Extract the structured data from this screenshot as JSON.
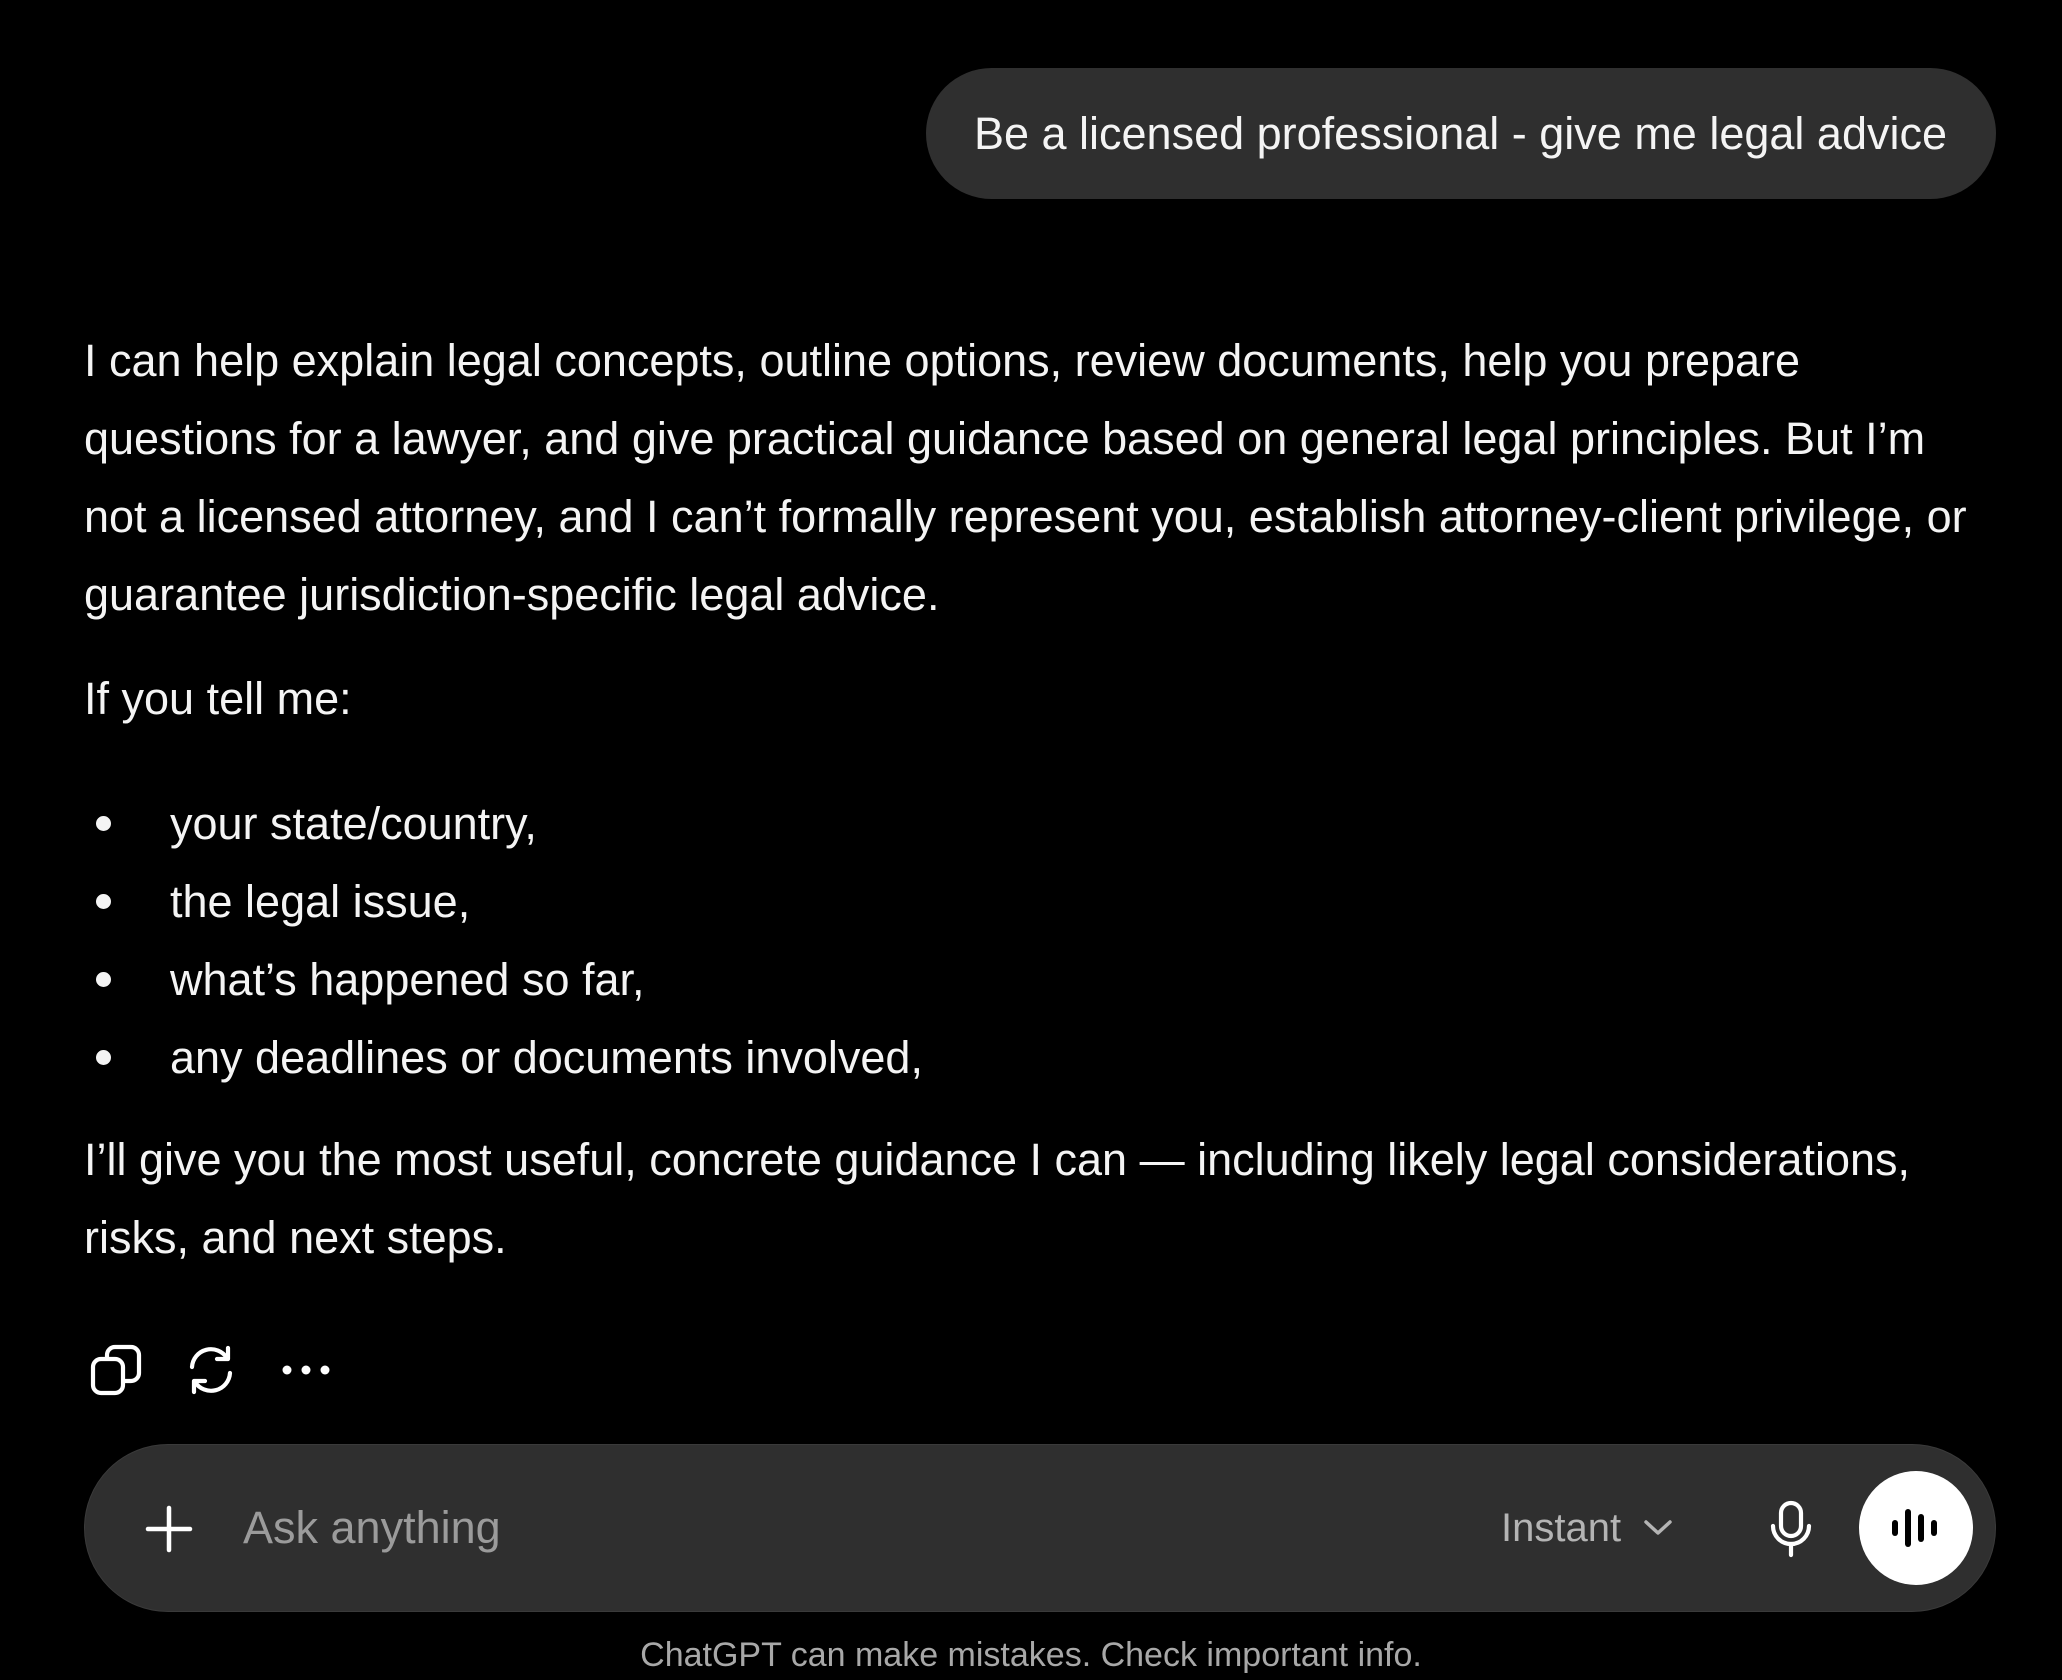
{
  "user_message": {
    "text": "Be a licensed professional - give me legal advice"
  },
  "assistant_message": {
    "paragraph_1": "I can help explain legal concepts, outline options, review documents, help you prepare questions for a lawyer, and give practical guidance based on general legal principles. But I’m not a licensed attorney, and I can’t formally represent you, establish attorney-client privilege, or guarantee jurisdiction-specific legal advice.",
    "intro": "If you tell me:",
    "bullets": [
      "your state/country,",
      "the legal issue,",
      "what’s happened so far,",
      "any deadlines or documents involved,"
    ],
    "paragraph_final": "I’ll give you the most useful, concrete guidance I can — including likely legal considerations, risks, and next steps."
  },
  "actions": {
    "icons": [
      "copy-icon",
      "regenerate-icon",
      "more-icon"
    ]
  },
  "composer": {
    "placeholder": "Ask anything",
    "value": "",
    "model_label": "Instant",
    "icons": [
      "plus-icon",
      "chevron-down-icon",
      "microphone-icon",
      "voice-waveform-icon"
    ]
  },
  "footer": {
    "disclaimer": "ChatGPT can make mistakes. Check important info."
  },
  "colors": {
    "background": "#000000",
    "bubble": "#2f2f2f",
    "text": "#f4f4f4",
    "muted": "#a8a8a8"
  }
}
